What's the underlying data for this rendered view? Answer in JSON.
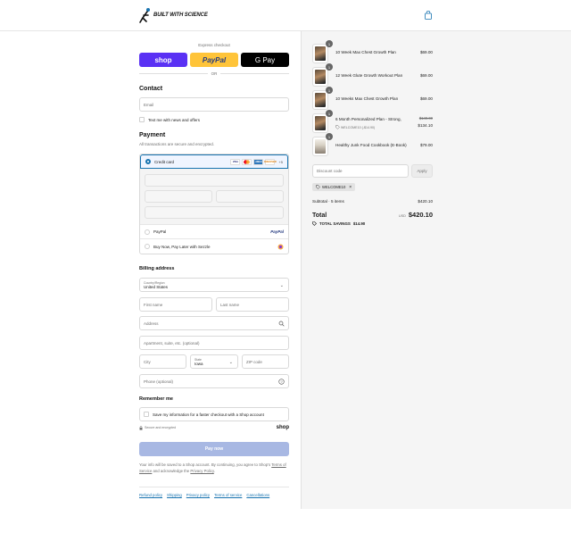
{
  "brand": {
    "name": "BUILT WITH SCIENCE",
    "logo_color": "#1773b0"
  },
  "express": {
    "title": "Express checkout",
    "shop_label": "shop",
    "paypal_label": "PayPal",
    "gpay_label": "G Pay",
    "or_label": "OR"
  },
  "contact": {
    "heading": "Contact",
    "email_placeholder": "Email",
    "news_label": "Text me with news and offers"
  },
  "payment": {
    "heading": "Payment",
    "subtitle": "All transactions are secure and encrypted.",
    "credit_card_label": "Credit card",
    "card_brands": [
      "VISA",
      "MC",
      "AMEX",
      "DISCOVER"
    ],
    "more_cards": "+5",
    "paypal_label": "PayPal",
    "paypal_logo": "PayPal",
    "sezzle_label": "Buy Now, Pay Later with Sezzle"
  },
  "billing": {
    "heading": "Billing address",
    "country_label": "Country/Region",
    "country_value": "United States",
    "first_name": "First name",
    "last_name": "Last name",
    "address": "Address",
    "apartment": "Apartment, suite, etc. (optional)",
    "city": "City",
    "state_label": "State",
    "state_value": "Iowa",
    "zip": "ZIP code",
    "phone": "Phone (optional)"
  },
  "remember": {
    "heading": "Remember me",
    "save_label": "Save my information for a faster checkout with a Shop account",
    "secure_label": "Secure and encrypted",
    "shop_word": "shop"
  },
  "pay_now": "Pay now",
  "legal": {
    "text_1": "Your info will be saved to a Shop account. By continuing, you agree to Shop's",
    "terms": "Terms of Service",
    "text_2": "and acknowledge the",
    "privacy": "Privacy Policy",
    "text_3": "."
  },
  "footer_links": [
    "Refund policy",
    "Shipping",
    "Privacy policy",
    "Terms of service",
    "Cancellations"
  ],
  "cart": {
    "items": [
      {
        "qty": "1",
        "name": "10 Week Max Chest Growth Plan",
        "price": "$69.00"
      },
      {
        "qty": "1",
        "name": "12 Week Glute Growth Workout Plan",
        "price": "$69.00"
      },
      {
        "qty": "1",
        "name": "10 Weeks Max Chest Growth Plan",
        "price": "$69.00"
      },
      {
        "qty": "1",
        "name": "6 Month Personalized Plan - Strong,",
        "discount": "WELCOME10 (-$14.90)",
        "original_price": "$149.00",
        "price": "$134.10"
      },
      {
        "qty": "1",
        "name": "Healthy Junk Food Cookbook (E-Book)",
        "price": "$79.00"
      }
    ],
    "discount_placeholder": "Discount code",
    "apply_label": "Apply",
    "applied_code": "WELCOME10",
    "subtotal_label": "Subtotal · 5 items",
    "subtotal_value": "$420.10",
    "total_label": "Total",
    "currency": "USD",
    "total_value": "$420.10",
    "savings_label": "TOTAL SAVINGS",
    "savings_value": "$14.90"
  }
}
